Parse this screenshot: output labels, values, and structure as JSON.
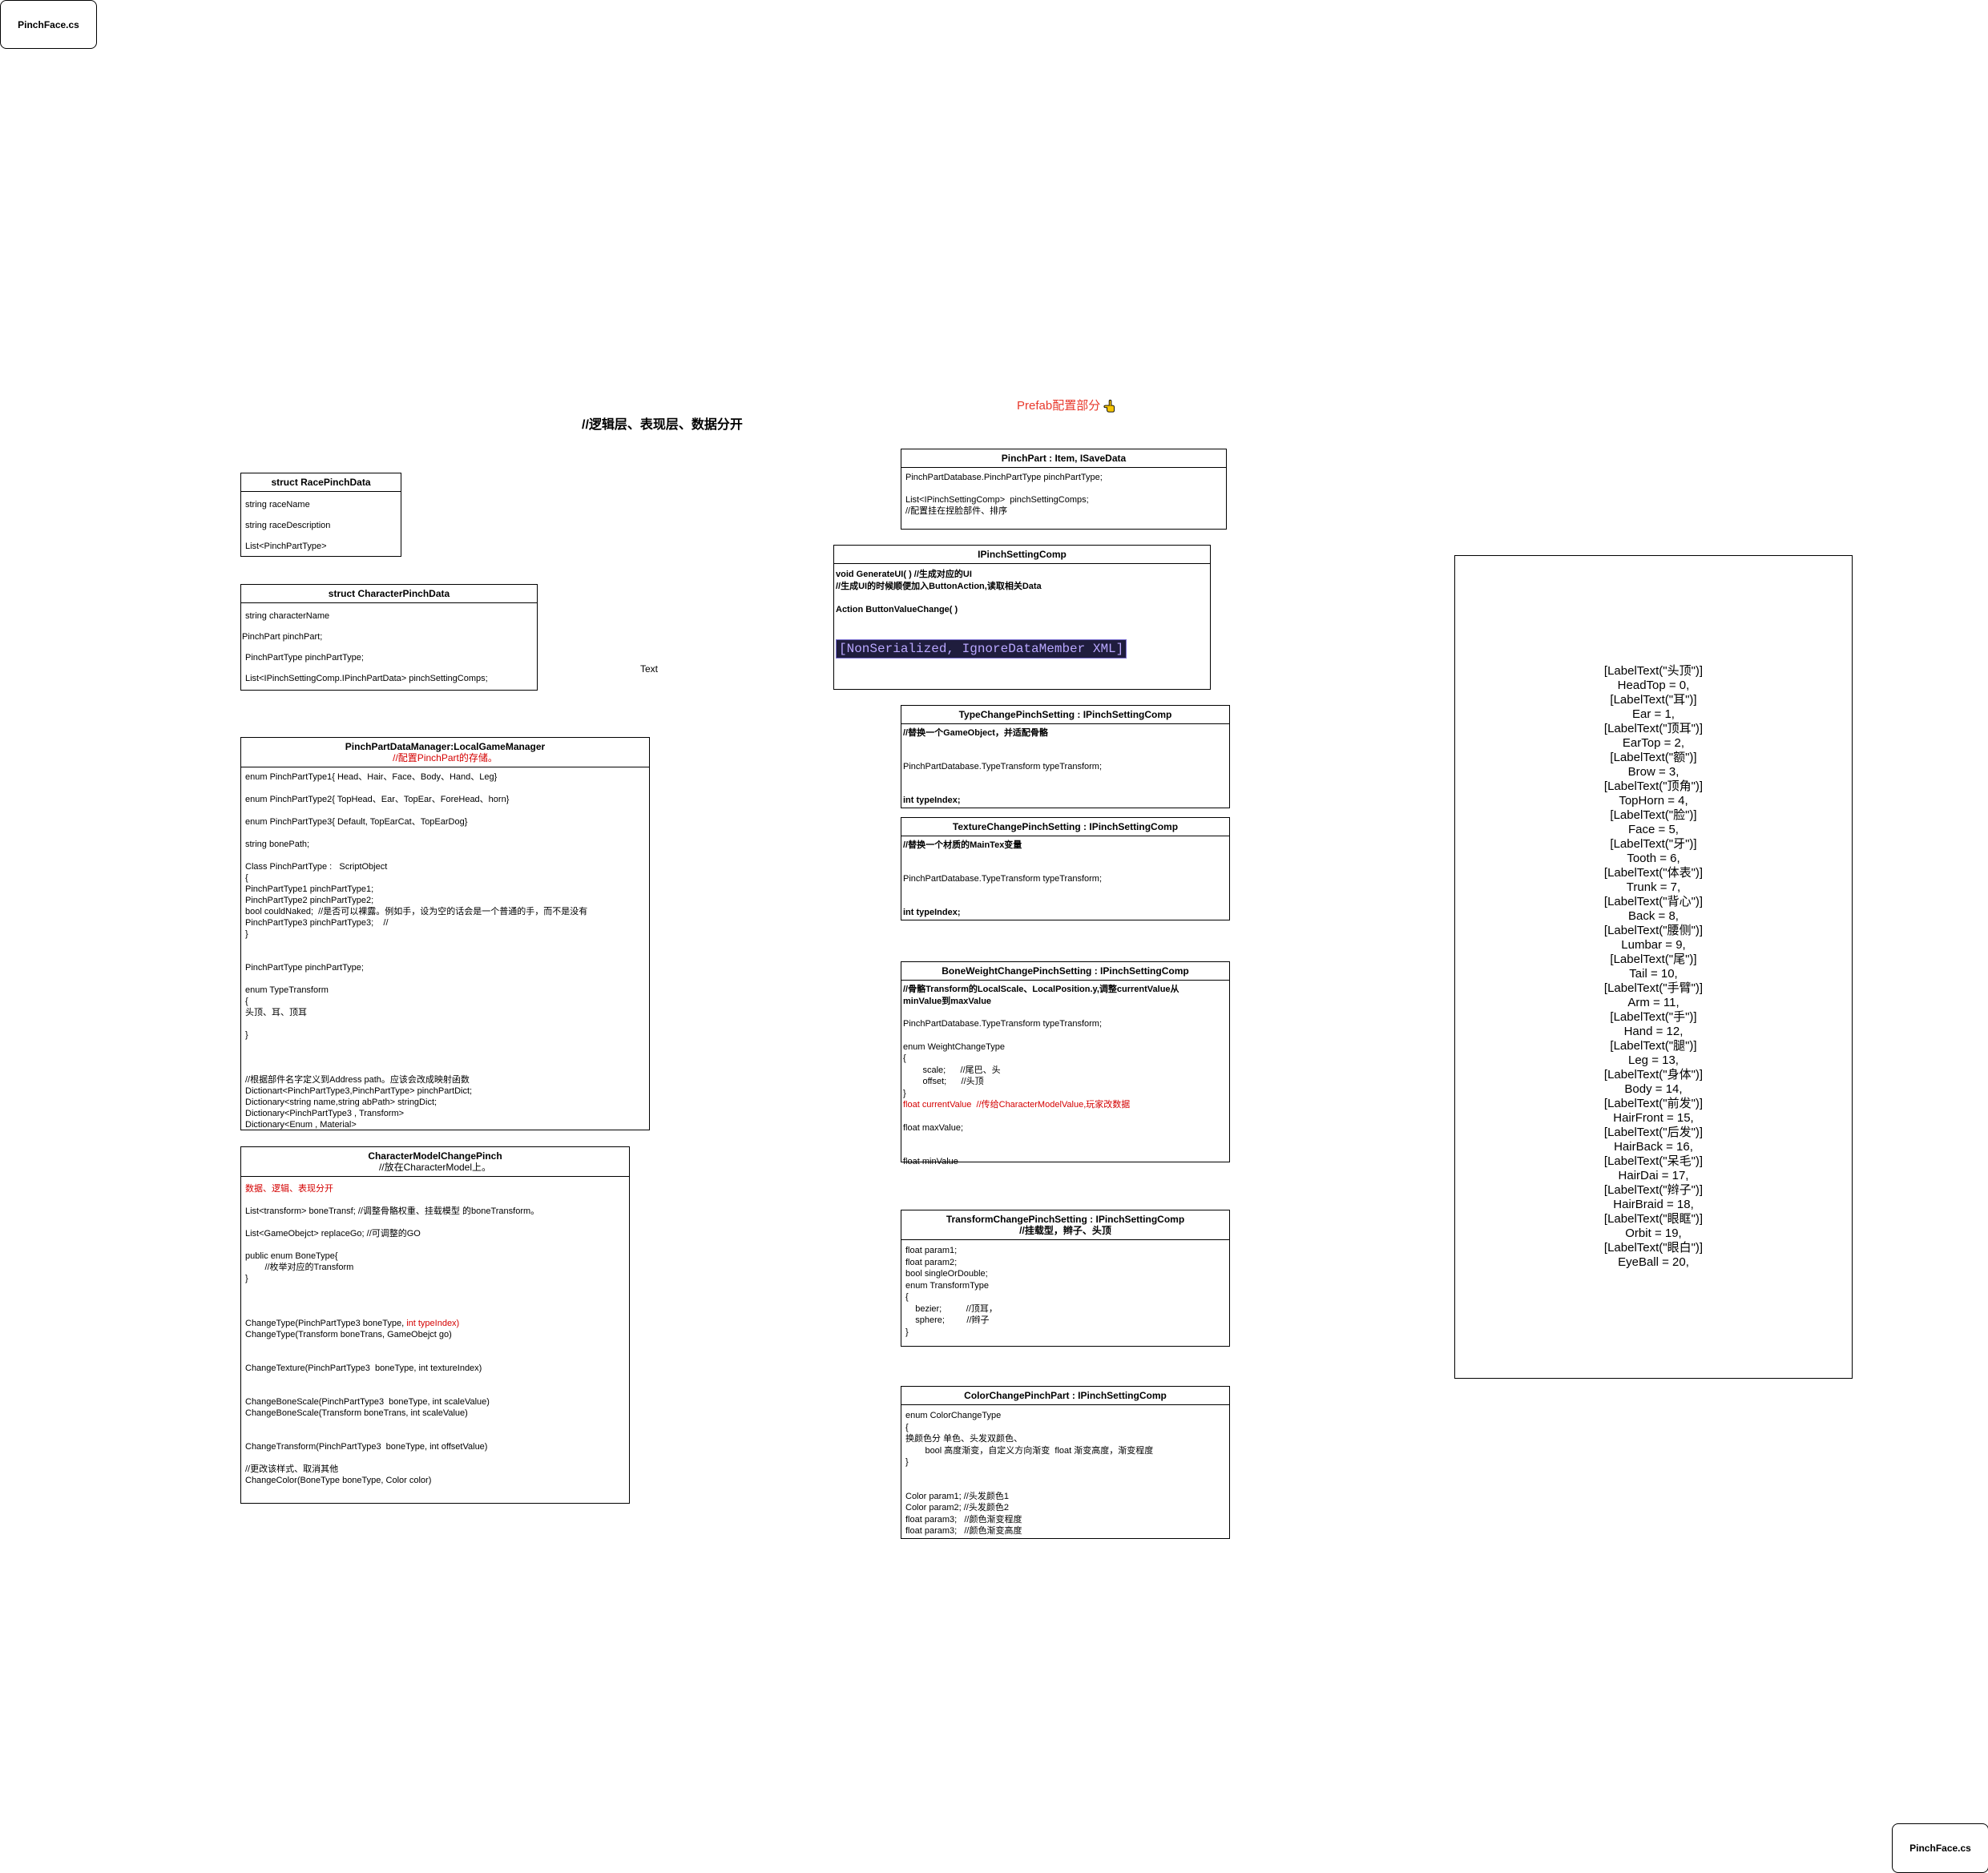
{
  "file_tabs": {
    "top_left": "PinchFace.cs",
    "bottom_right": "PinchFace.cs"
  },
  "headings": {
    "layers": "//逻辑层、表现层、数据分开",
    "prefab": "Prefab配置部分",
    "text_label": "Text"
  },
  "race": {
    "title": "struct RacePinchData",
    "lines": [
      "string raceName",
      "string raceDescription",
      "List<PinchPartType>"
    ]
  },
  "character": {
    "title": "struct CharacterPinchData",
    "lines": [
      "string characterName",
      "PinchPart pinchPart;",
      "PinchPartType pinchPartType;",
      "List<IPinchSettingComp.IPinchPartData> pinchSettingComps;"
    ]
  },
  "manager": {
    "title": "PinchPartDataManager:LocalGameManager",
    "subtitle": "//配置PinchPart的存储。",
    "lines": [
      "enum PinchPartType1{ Head、Hair、Face、Body、Hand、Leg}",
      "",
      "enum PinchPartType2{ TopHead、Ear、TopEar、ForeHead、horn}",
      "",
      "enum PinchPartType3{ Default, TopEarCat、TopEarDog}",
      "",
      "string bonePath;",
      "",
      "Class PinchPartType :   ScriptObject",
      "{",
      "PinchPartType1 pinchPartType1;",
      "PinchPartType2 pinchPartType2;",
      "bool couldNaked;  //是否可以裸露。例如手，设为空的话会是一个普通的手，而不是没有",
      "PinchPartType3 pinchPartType3;    //",
      "}",
      "",
      "",
      "PinchPartType pinchPartType;",
      "",
      "enum TypeTransform",
      "{",
      "头顶、耳、顶耳",
      "",
      "}",
      "",
      "",
      "",
      "//根据部件名字定义到Address path。应该会改成映射函数",
      "Dictionart<PinchPartType3,PinchPartType> pinchPartDict;",
      "Dictionary<string name,string abPath> stringDict;",
      "Dictionary<PinchPartType3 , Transform>",
      "Dictionary<Enum , Material>"
    ]
  },
  "model_change": {
    "title": "CharacterModelChangePinch",
    "subtitle": "//放在CharacterModel上。",
    "red_line": "数据、逻辑、表现分开",
    "lines_a": [
      "List<transform> boneTransf; //调整骨骼权重、挂载模型 的boneTransform。",
      "",
      "List<GameObejct> replaceGo; //可调整的GO",
      "",
      "public enum BoneType{",
      "        //枚举对应的Transform",
      "}",
      "",
      "",
      ""
    ],
    "change_type_prefix": "ChangeType(PinchPartType3 boneType, ",
    "change_type_red": "int typeIndex)",
    "lines_b": [
      "ChangeType(Transform boneTrans, GameObejct go)",
      "",
      "",
      "ChangeTexture(PinchPartType3  boneType, int textureIndex)",
      "",
      "",
      "ChangeBoneScale(PinchPartType3  boneType, int scaleValue)",
      "ChangeBoneScale(Transform boneTrans, int scaleValue)",
      "",
      "",
      "ChangeTransform(PinchPartType3  boneType, int offsetValue)",
      "",
      "//更改该样式、取消其他",
      "ChangeColor(BoneType boneType, Color color)"
    ]
  },
  "pinch_part": {
    "title": "PinchPart : Item, ISaveData",
    "lines": [
      "PinchPartDatabase.PinchPartType pinchPartType;",
      "",
      "List<IPinchSettingComp>  pinchSettingComps;",
      "//配置挂在捏脸部件、排序"
    ]
  },
  "ipinch": {
    "title": "IPinchSettingComp",
    "lines": [
      "void GenerateUI( ) //生成对应的UI",
      "//生成UI的时候顺便加入ButtonAction,读取相关Data",
      "",
      "Action ButtonValueChange( )"
    ],
    "code_highlight": "[NonSerialized, IgnoreDataMember XML]"
  },
  "type_change": {
    "title": "TypeChangePinchSetting : IPinchSettingComp",
    "lines": [
      "//替换一个GameObject，并适配骨骼",
      "",
      "",
      "PinchPartDatabase.TypeTransform typeTransform;",
      "",
      "",
      "int typeIndex;"
    ]
  },
  "texture_change": {
    "title": "TextureChangePinchSetting : IPinchSettingComp",
    "lines": [
      "//替换一个材质的MainTex变量",
      "",
      "",
      "PinchPartDatabase.TypeTransform typeTransform;",
      "",
      "",
      "int typeIndex;"
    ]
  },
  "bone_weight": {
    "title": "BoneWeightChangePinchSetting : IPinchSettingComp",
    "lines_a": [
      "//骨骼Transform的LocalScale、LocalPosition.y,调整currentValue从",
      "minValue到maxValue",
      "",
      "PinchPartDatabase.TypeTransform typeTransform;",
      "",
      "enum WeightChangeType",
      "{",
      "        scale;      //尾巴、头",
      "        offset;      //头顶",
      "}"
    ],
    "red_line": "float currentValue  //传给CharacterModelValue,玩家改数据",
    "lines_b": [
      "",
      "float maxValue;",
      "",
      "",
      "float minValue"
    ]
  },
  "transform_change": {
    "title": "TransformChangePinchSetting : IPinchSettingComp",
    "subtitle": "//挂载型，辫子、头顶",
    "lines": [
      "float param1;",
      "float param2;",
      "bool singleOrDouble;",
      "enum TransformType",
      "{",
      "    bezier;          //顶耳，",
      "    sphere;         //辫子",
      "}"
    ]
  },
  "color_change": {
    "title": "ColorChangePinchPart : IPinchSettingComp",
    "lines": [
      "enum ColorChangeType",
      "{",
      "换颜色分 单色、头发双颜色、",
      "        bool 高度渐变，自定义方向渐变  float 渐变高度，渐变程度",
      "}",
      "",
      "",
      "Color param1; //头发颜色1",
      "Color param2; //头发颜色2",
      "float param3;   //颜色渐变程度",
      "float param3;   //颜色渐变高度"
    ]
  },
  "enum_list": [
    "[LabelText(\"头顶\")]",
    "HeadTop = 0,",
    "[LabelText(\"耳\")]",
    "Ear = 1,",
    "[LabelText(\"顶耳\")]",
    "EarTop = 2,",
    "[LabelText(\"额\")]",
    "Brow = 3,",
    "[LabelText(\"顶角\")]",
    "TopHorn = 4,",
    "[LabelText(\"脸\")]",
    "Face = 5,",
    "[LabelText(\"牙\")]",
    "Tooth = 6,",
    "[LabelText(\"体表\")]",
    "Trunk = 7,",
    "[LabelText(\"背心\")]",
    "Back = 8,",
    "[LabelText(\"腰侧\")]",
    "Lumbar = 9,",
    "[LabelText(\"尾\")]",
    "Tail = 10,",
    "[LabelText(\"手臂\")]",
    "Arm = 11,",
    "[LabelText(\"手\")]",
    "Hand = 12,",
    "[LabelText(\"腿\")]",
    "Leg = 13,",
    "[LabelText(\"身体\")]",
    "Body = 14,",
    "[LabelText(\"前发\")]",
    "HairFront = 15,",
    "[LabelText(\"后发\")]",
    "HairBack = 16,",
    "[LabelText(\"呆毛\")]",
    "HairDai = 17,",
    "[LabelText(\"辫子\")]",
    "HairBraid = 18,",
    "[LabelText(\"眼眶\")]",
    "Orbit = 19,",
    "[LabelText(\"眼白\")]",
    "EyeBall = 20,"
  ],
  "colors": {
    "accent_red": "#d40000",
    "code_bg": "#1f1d3d",
    "code_fg": "#b9a7ff",
    "hand_icon": "#f5c400"
  }
}
